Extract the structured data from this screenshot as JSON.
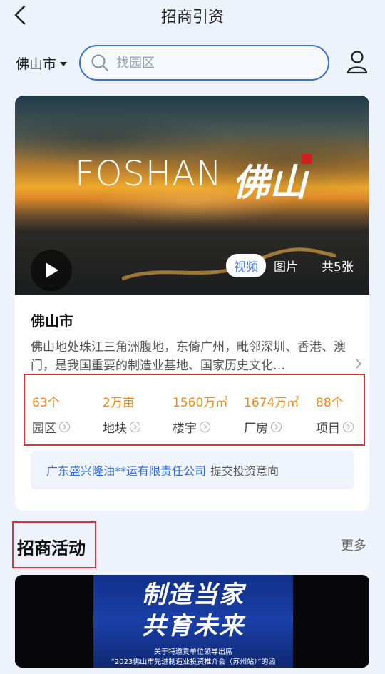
{
  "nav": {
    "title": "招商引资"
  },
  "search": {
    "city": "佛山市",
    "placeholder": "找园区"
  },
  "hero": {
    "brand_en": "FOSHAN",
    "brand_cn": "佛山",
    "tabs": [
      "视频",
      "图片"
    ],
    "active_tab": 0,
    "count": "共5张"
  },
  "info": {
    "title": "佛山市",
    "description": "佛山地处珠江三角洲腹地，东倚广州，毗邻深圳、香港、澳门，是我国重要的制造业基地、国家历史文化…"
  },
  "stats": [
    {
      "value": "63个",
      "label": "园区"
    },
    {
      "value": "2万亩",
      "label": "地块"
    },
    {
      "value": "1560万㎡",
      "label": "楼宇"
    },
    {
      "value": "1674万㎡",
      "label": "厂房"
    },
    {
      "value": "88个",
      "label": "项目"
    }
  ],
  "notice": {
    "company": "广东盛兴隆油**运有限责任公司",
    "text": "提交投资意向"
  },
  "section": {
    "title": "招商活动",
    "more": "更多"
  },
  "banner": {
    "line1": "制造当家",
    "line2": "共育未来",
    "line3": "关于特邀贵单位领导出席",
    "line4": "“2023佛山市先进制造业投资推介会（苏州站）”的函"
  },
  "colors": {
    "accent": "#3b6fd6",
    "orange": "#f08a14",
    "highlight": "#d8353a"
  }
}
